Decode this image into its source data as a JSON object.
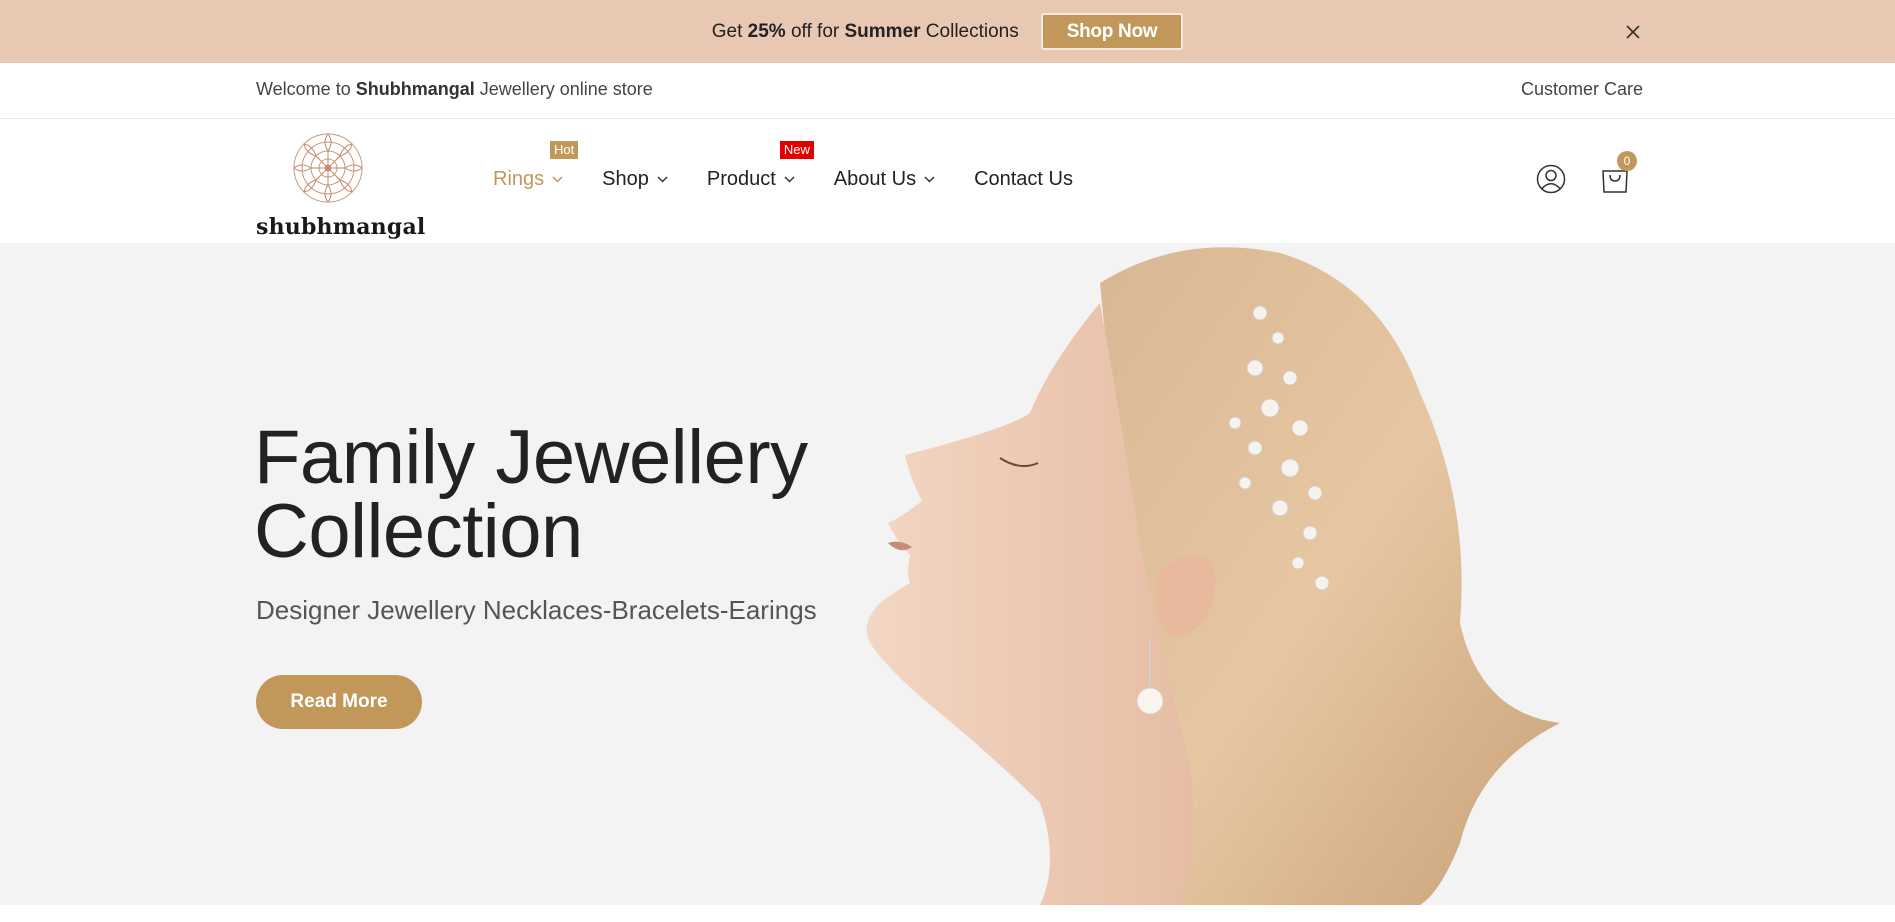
{
  "promo": {
    "text_before": "Get ",
    "discount": "25%",
    "text_mid": " off for ",
    "season": "Summer",
    "text_after": " Collections",
    "cta_label": "Shop Now",
    "close_icon": "close-icon"
  },
  "topbar": {
    "welcome_before": "Welcome to ",
    "store_name": "Shubhmangal",
    "welcome_after": " Jewellery online store",
    "customer_care": "Customer Care"
  },
  "header": {
    "logo_text": "shubhmangal",
    "nav": [
      {
        "label": "Rings",
        "badge": "Hot",
        "active": true
      },
      {
        "label": "Shop"
      },
      {
        "label": "Product",
        "badge": "New"
      },
      {
        "label": "About Us"
      },
      {
        "label": "Contact Us"
      }
    ],
    "cart_count": "0",
    "icons": [
      "user-icon",
      "cart-icon"
    ]
  },
  "hero": {
    "title_line1": "Family Jewellery",
    "title_line2": "Collection",
    "subtitle": "Designer Jewellery Necklaces-Bracelets-Earings",
    "cta_label": "Read More"
  },
  "colors": {
    "promo_bg": "#e8c8b3",
    "accent": "#c2985a",
    "new_badge": "#e00000",
    "hero_bg": "#f3f3f3"
  }
}
